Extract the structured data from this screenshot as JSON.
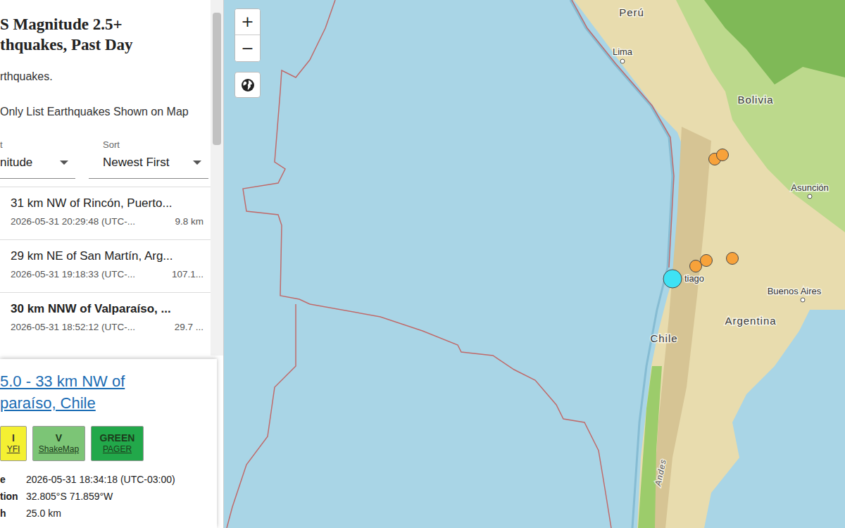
{
  "panel": {
    "title_lines": [
      "S Magnitude 2.5+",
      "thquakes, Past Day"
    ],
    "subtitle": "rthquakes.",
    "filter_label": "Only List Earthquakes Shown on Map"
  },
  "selects": [
    {
      "label": "t",
      "value": "nitude"
    },
    {
      "label": "Sort",
      "value": "Newest First"
    }
  ],
  "events": [
    {
      "title": "31 km NW of Rincón, Puerto...",
      "time": "2026-05-31 20:29:48 (UTC-...",
      "depth": "9.8 km",
      "selected": false
    },
    {
      "title": "29 km NE of San Martín, Arg...",
      "time": "2026-05-31 19:18:33 (UTC-...",
      "depth": "107.1...",
      "selected": false
    },
    {
      "title": "30 km NNW of Valparaíso, ...",
      "time": "2026-05-31 18:52:12 (UTC-...",
      "depth": "29.7 ...",
      "selected": true
    }
  ],
  "detail": {
    "title_lines": [
      "5.0 - 33 km NW of",
      "paraíso, Chile"
    ],
    "badges": [
      {
        "top": "I",
        "bottom": "YFI",
        "color": "#f4f032"
      },
      {
        "top": "V",
        "bottom": "ShakeMap",
        "color": "#7cc576"
      },
      {
        "top": "GREEN",
        "bottom": "PAGER",
        "color": "#22a84a"
      }
    ],
    "rows": [
      {
        "label": "e",
        "value": "2026-05-31 18:34:18 (UTC-03:00)"
      },
      {
        "label": "tion",
        "value": "32.805°S 71.859°W"
      },
      {
        "label": "h",
        "value": "25.0 km"
      }
    ]
  },
  "map": {
    "zoom_in": "+",
    "zoom_out": "−",
    "labels": [
      {
        "text": "Perú",
        "kind": "country"
      },
      {
        "text": "Lima",
        "kind": "city"
      },
      {
        "text": "Bolivia",
        "kind": "country"
      },
      {
        "text": "Asunción",
        "kind": "city"
      },
      {
        "text": "Buenos Aires",
        "kind": "city"
      },
      {
        "text": "Argentina",
        "kind": "country"
      },
      {
        "text": "Chile",
        "kind": "country"
      },
      {
        "text": "Andes",
        "kind": "range"
      },
      {
        "text": "tiago",
        "kind": "city"
      }
    ],
    "markers": [
      {
        "color": "#f7a23a",
        "selected": false
      },
      {
        "color": "#f7a23a",
        "selected": false
      },
      {
        "color": "#f7a23a",
        "selected": false
      },
      {
        "color": "#f7a23a",
        "selected": false
      },
      {
        "color": "#f7a23a",
        "selected": false
      },
      {
        "color": "#3fe2f4",
        "selected": true
      }
    ]
  }
}
